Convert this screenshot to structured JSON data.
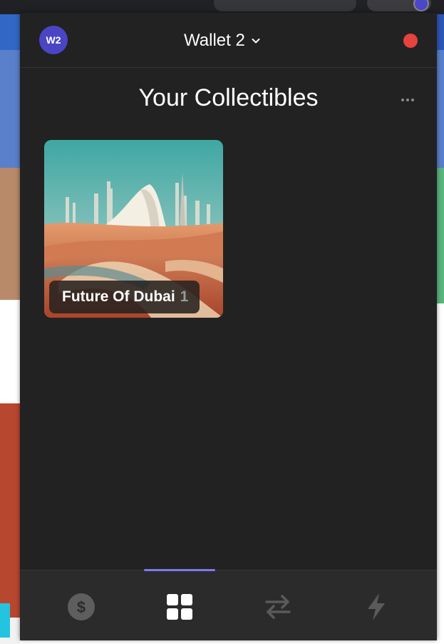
{
  "header": {
    "avatar_text": "W2",
    "wallet_name": "Wallet 2",
    "status_color": "#e6423e"
  },
  "page": {
    "title": "Your Collectibles"
  },
  "collectibles": [
    {
      "name": "Future Of Dubai",
      "count": "1"
    }
  ],
  "tabs": [
    {
      "id": "balances",
      "icon": "dollar-coin-icon",
      "active": false
    },
    {
      "id": "collectibles",
      "icon": "grid-icon",
      "active": true
    },
    {
      "id": "swap",
      "icon": "swap-arrows-icon",
      "active": false
    },
    {
      "id": "activity",
      "icon": "lightning-icon",
      "active": false
    }
  ],
  "colors": {
    "background": "#222222",
    "tab_bar": "#2b2b2b",
    "accent": "#7e79ee",
    "avatar": "#4a45c4",
    "inactive_icon": "#5a5a5a"
  }
}
